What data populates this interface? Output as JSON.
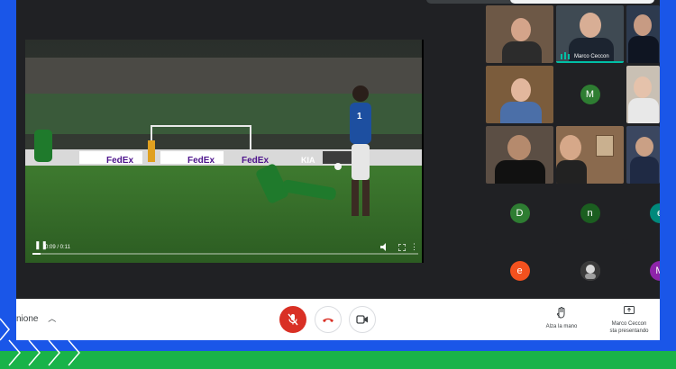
{
  "presentation": {
    "time": "0:09 / 0:11",
    "progress": 0.02,
    "scene": {
      "ad_boards": [
        "FedEx",
        "FedEx",
        "FedEx",
        "KIA"
      ],
      "player_number": "1"
    }
  },
  "participants": [
    {
      "type": "video",
      "name": ""
    },
    {
      "type": "video",
      "name": "Marco Ceccon",
      "speaking": true
    },
    {
      "type": "video",
      "name": ""
    },
    {
      "type": "video",
      "name": ""
    },
    {
      "type": "avatar",
      "initial": "M",
      "color": "#2e7d32"
    },
    {
      "type": "video",
      "name": ""
    },
    {
      "type": "video",
      "name": ""
    },
    {
      "type": "video",
      "name": ""
    },
    {
      "type": "video",
      "name": ""
    },
    {
      "type": "avatar",
      "initial": "D",
      "color": "#2e7d32"
    },
    {
      "type": "avatar",
      "initial": "n",
      "color": "#1b5e20"
    },
    {
      "type": "avatar",
      "initial": "e",
      "color": "#00897b"
    },
    {
      "type": "avatar",
      "initial": "e",
      "color": "#f4511e"
    },
    {
      "type": "photo-avatar"
    },
    {
      "type": "avatar",
      "initial": "M",
      "color": "#8e24aa"
    }
  ],
  "bottombar": {
    "meeting_details_label": "nione",
    "raise_hand_label": "Alza la mano",
    "presenter_line1": "Marco Ceccon",
    "presenter_line2": "sta presentando"
  },
  "colors": {
    "background": "#1a56e8",
    "green_band": "#19b349",
    "mic_off": "#d93025",
    "hangup": "#d93025",
    "speaking": "#00bfa5"
  },
  "icons": [
    "play-pause-icon",
    "volume-icon",
    "fullscreen-icon",
    "more-vert-icon",
    "mic-off-icon",
    "hangup-icon",
    "camera-icon",
    "raise-hand-icon",
    "present-screen-icon",
    "chevron-up-icon",
    "audio-bars-icon"
  ]
}
